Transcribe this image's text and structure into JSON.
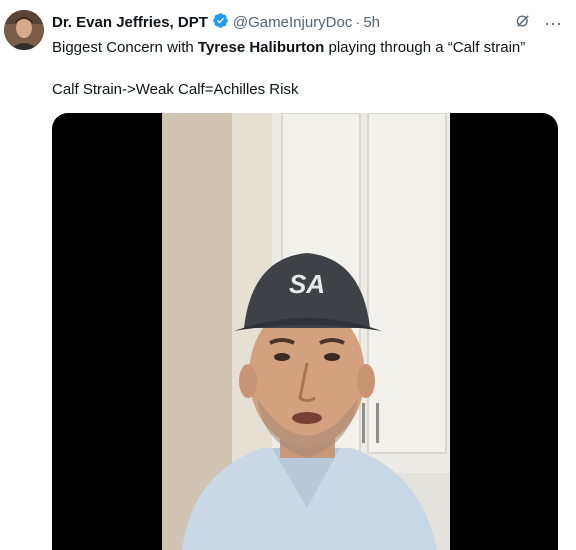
{
  "author": {
    "display_name": "Dr. Evan Jeffries, DPT",
    "handle": "@GameInjuryDoc",
    "separator": "·",
    "time": "5h"
  },
  "icons": {
    "verified": "verified-badge-icon",
    "grok": "grok-icon",
    "more": "more-icon"
  },
  "tweet": {
    "line1_pre": "Biggest Concern with ",
    "line1_bold": "Tyrese Haliburton",
    "line1_post": " playing through a “Calf strain”",
    "line2": "Calf Strain->Weak Calf=Achilles Risk"
  },
  "video": {
    "cap_logo": "SA"
  },
  "colors": {
    "verified": "#1d9bf0",
    "secondary_text": "#536471",
    "primary_text": "#0f1419"
  }
}
